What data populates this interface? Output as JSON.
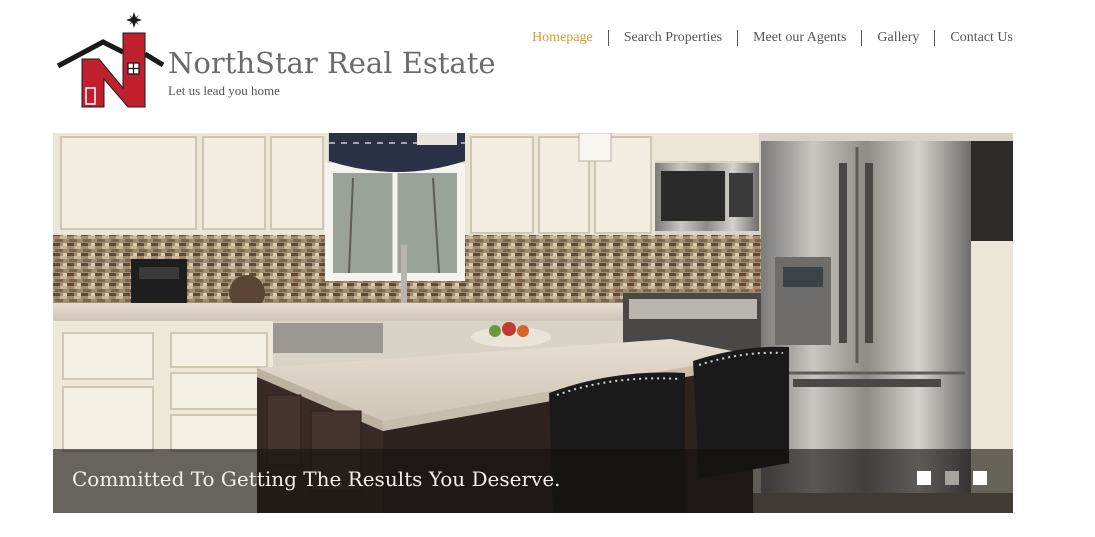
{
  "brand": {
    "name": "NorthStar Real Estate",
    "tagline": "Let us lead you home",
    "colors": {
      "red": "#c0202e",
      "dark": "#1a1a1a",
      "text": "#6b6b6b"
    }
  },
  "nav": {
    "items": [
      {
        "label": "Homepage",
        "active": true
      },
      {
        "label": "Search Properties",
        "active": false
      },
      {
        "label": "Meet our Agents",
        "active": false
      },
      {
        "label": "Gallery",
        "active": false
      },
      {
        "label": "Contact Us",
        "active": false
      }
    ],
    "active_color": "#e8952d",
    "color": "#555555"
  },
  "hero": {
    "caption": "Committed To Getting The Results You Deserve.",
    "slides": 3,
    "active_slide": 2
  }
}
